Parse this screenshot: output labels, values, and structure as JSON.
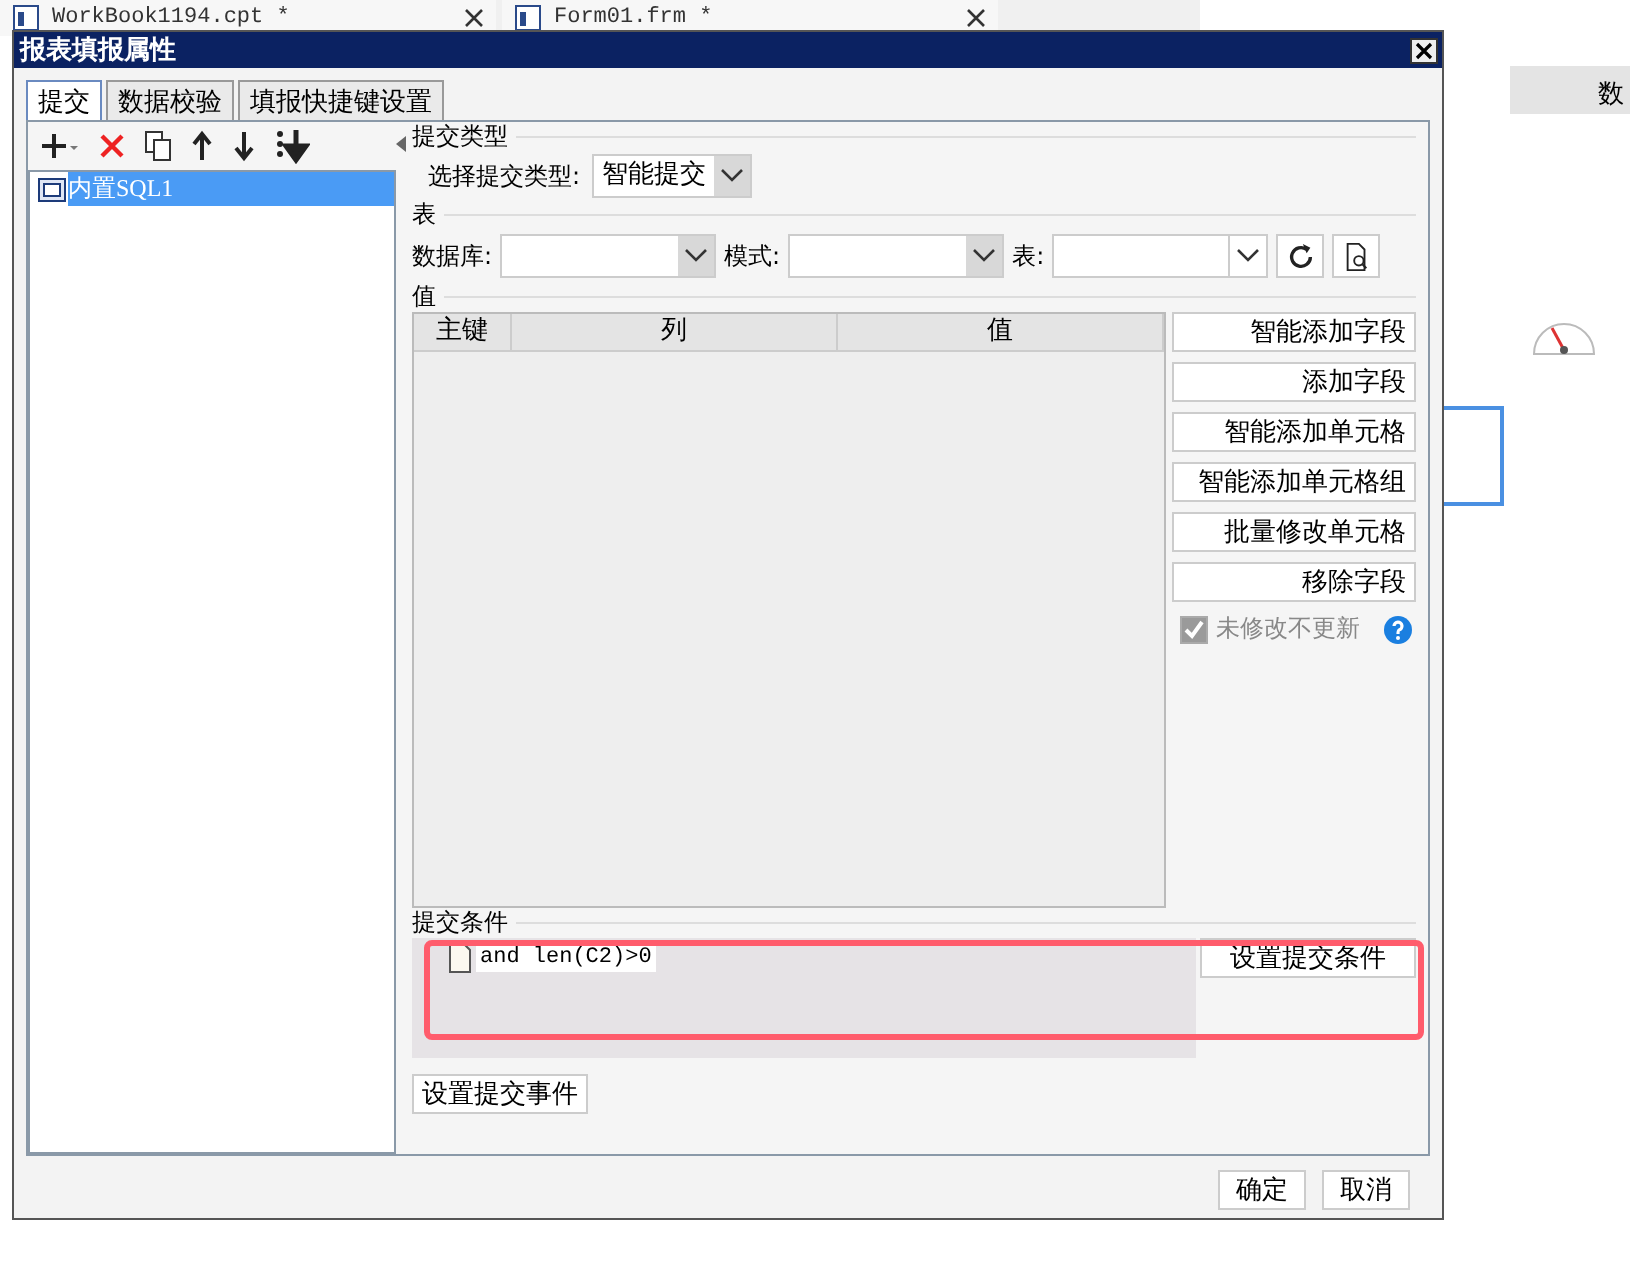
{
  "background": {
    "tabs": [
      {
        "label": "WorkBook1194.cpt *"
      },
      {
        "label": "Form01.frm *"
      }
    ],
    "side_button": "数"
  },
  "dialog": {
    "title": "报表填报属性",
    "tabs": [
      {
        "label": "提交",
        "selected": true
      },
      {
        "label": "数据校验",
        "selected": false
      },
      {
        "label": "填报快捷键设置",
        "selected": false
      }
    ],
    "items": [
      {
        "label": "内置SQL1",
        "selected": true
      }
    ],
    "submit_type": {
      "section": "提交类型",
      "label": "选择提交类型:",
      "value": "智能提交"
    },
    "table": {
      "section": "表",
      "database_label": "数据库:",
      "schema_label": "模式:",
      "table_label": "表:"
    },
    "values": {
      "section": "值",
      "columns": [
        "主键",
        "列",
        "值"
      ],
      "buttons": [
        "智能添加字段",
        "添加字段",
        "智能添加单元格",
        "智能添加单元格组",
        "批量修改单元格",
        "移除字段"
      ],
      "checkbox": {
        "label": "未修改不更新",
        "checked": true,
        "disabled": true
      }
    },
    "condition": {
      "section": "提交条件",
      "highlighted": true,
      "items": [
        {
          "text": "and len(C2)>0"
        }
      ],
      "button": "设置提交条件"
    },
    "event_button": "设置提交事件",
    "footer": [
      "确定",
      "取消"
    ]
  }
}
